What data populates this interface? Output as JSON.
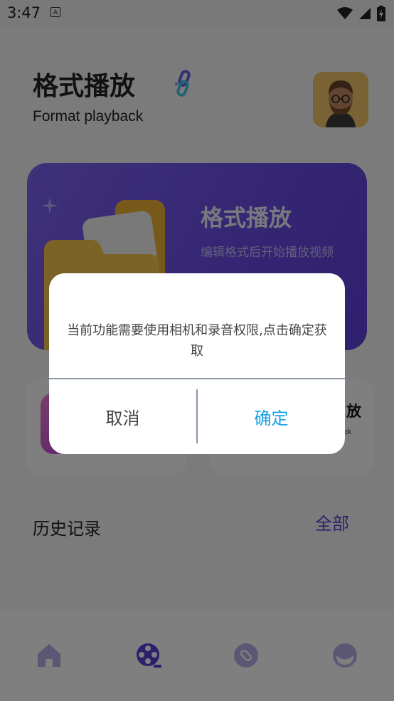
{
  "status_bar": {
    "time": "3:47",
    "app_icon_letter": "A",
    "icons": [
      "wifi-icon",
      "signal-icon",
      "battery-charging-icon"
    ]
  },
  "header": {
    "title": "格式播放",
    "subtitle": "Format playback"
  },
  "banner": {
    "title": "格式播放",
    "subtitle": "编辑格式后开始播放视频"
  },
  "cards": [
    {
      "title": "",
      "subtitle": ""
    },
    {
      "title": "放",
      "subtitle": "ck"
    }
  ],
  "history": {
    "title": "历史记录",
    "all_label": "全部"
  },
  "bottom_nav": {
    "items": [
      "home-icon",
      "film-reel-icon",
      "link-icon",
      "profile-icon"
    ],
    "active_index": 1
  },
  "dialog": {
    "message": "当前功能需要使用相机和录音权限,点击确定获取",
    "cancel_label": "取消",
    "confirm_label": "确定"
  },
  "colors": {
    "accent": "#5a3fd6",
    "banner": "#6a4ce6",
    "confirm": "#17a3e8"
  }
}
